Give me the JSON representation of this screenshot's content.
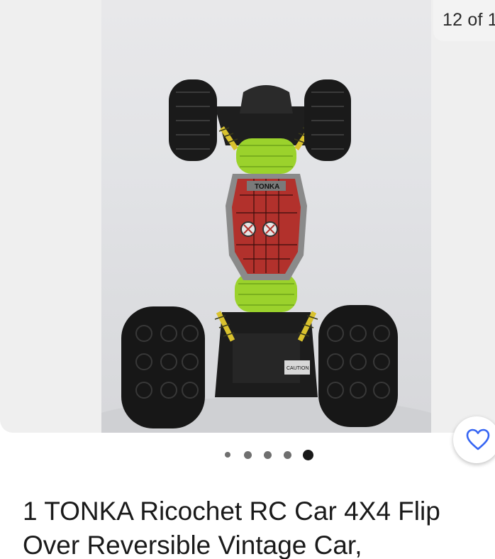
{
  "gallery": {
    "counter_text": "12 of 1",
    "image_alt": "Tonka Ricochet RC car, top view",
    "model_badge": "TONKA",
    "warning_label": "CAUTION"
  },
  "carousel": {
    "total_dots": 5,
    "active_index": 4
  },
  "listing": {
    "title_line1": "1 TONKA Ricochet RC Car 4X4 Flip",
    "title_line2": "Over Reversible Vintage Car,"
  },
  "icons": {
    "watch": "heart-icon"
  },
  "colors": {
    "accent": "#3665f3",
    "text": "#1a1a1a",
    "gallery_bg": "#efefef",
    "dot_inactive": "#6f6f6f",
    "dot_active": "#191919"
  }
}
